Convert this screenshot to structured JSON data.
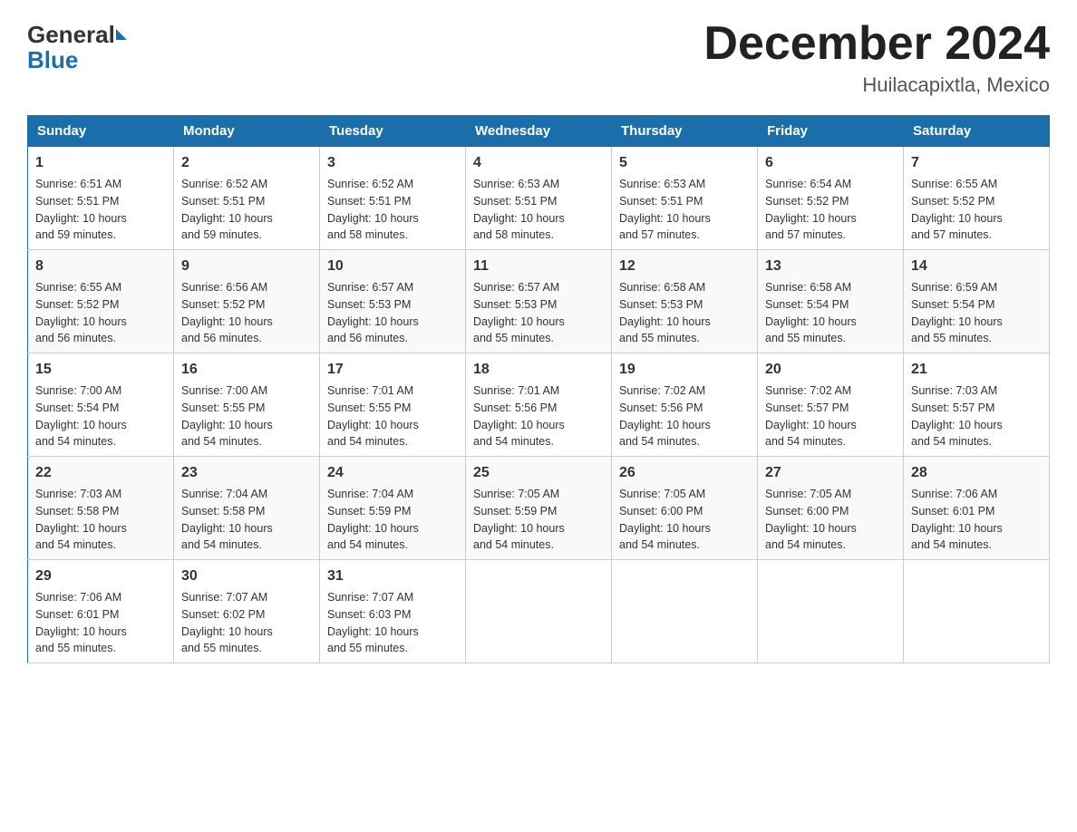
{
  "logo": {
    "general": "General",
    "blue": "Blue",
    "subtitle": "Blue"
  },
  "header": {
    "title": "December 2024",
    "location": "Huilacapixtla, Mexico"
  },
  "weekdays": [
    "Sunday",
    "Monday",
    "Tuesday",
    "Wednesday",
    "Thursday",
    "Friday",
    "Saturday"
  ],
  "weeks": [
    [
      {
        "day": "1",
        "sunrise": "Sunrise: 6:51 AM",
        "sunset": "Sunset: 5:51 PM",
        "daylight": "Daylight: 10 hours",
        "daylight2": "and 59 minutes."
      },
      {
        "day": "2",
        "sunrise": "Sunrise: 6:52 AM",
        "sunset": "Sunset: 5:51 PM",
        "daylight": "Daylight: 10 hours",
        "daylight2": "and 59 minutes."
      },
      {
        "day": "3",
        "sunrise": "Sunrise: 6:52 AM",
        "sunset": "Sunset: 5:51 PM",
        "daylight": "Daylight: 10 hours",
        "daylight2": "and 58 minutes."
      },
      {
        "day": "4",
        "sunrise": "Sunrise: 6:53 AM",
        "sunset": "Sunset: 5:51 PM",
        "daylight": "Daylight: 10 hours",
        "daylight2": "and 58 minutes."
      },
      {
        "day": "5",
        "sunrise": "Sunrise: 6:53 AM",
        "sunset": "Sunset: 5:51 PM",
        "daylight": "Daylight: 10 hours",
        "daylight2": "and 57 minutes."
      },
      {
        "day": "6",
        "sunrise": "Sunrise: 6:54 AM",
        "sunset": "Sunset: 5:52 PM",
        "daylight": "Daylight: 10 hours",
        "daylight2": "and 57 minutes."
      },
      {
        "day": "7",
        "sunrise": "Sunrise: 6:55 AM",
        "sunset": "Sunset: 5:52 PM",
        "daylight": "Daylight: 10 hours",
        "daylight2": "and 57 minutes."
      }
    ],
    [
      {
        "day": "8",
        "sunrise": "Sunrise: 6:55 AM",
        "sunset": "Sunset: 5:52 PM",
        "daylight": "Daylight: 10 hours",
        "daylight2": "and 56 minutes."
      },
      {
        "day": "9",
        "sunrise": "Sunrise: 6:56 AM",
        "sunset": "Sunset: 5:52 PM",
        "daylight": "Daylight: 10 hours",
        "daylight2": "and 56 minutes."
      },
      {
        "day": "10",
        "sunrise": "Sunrise: 6:57 AM",
        "sunset": "Sunset: 5:53 PM",
        "daylight": "Daylight: 10 hours",
        "daylight2": "and 56 minutes."
      },
      {
        "day": "11",
        "sunrise": "Sunrise: 6:57 AM",
        "sunset": "Sunset: 5:53 PM",
        "daylight": "Daylight: 10 hours",
        "daylight2": "and 55 minutes."
      },
      {
        "day": "12",
        "sunrise": "Sunrise: 6:58 AM",
        "sunset": "Sunset: 5:53 PM",
        "daylight": "Daylight: 10 hours",
        "daylight2": "and 55 minutes."
      },
      {
        "day": "13",
        "sunrise": "Sunrise: 6:58 AM",
        "sunset": "Sunset: 5:54 PM",
        "daylight": "Daylight: 10 hours",
        "daylight2": "and 55 minutes."
      },
      {
        "day": "14",
        "sunrise": "Sunrise: 6:59 AM",
        "sunset": "Sunset: 5:54 PM",
        "daylight": "Daylight: 10 hours",
        "daylight2": "and 55 minutes."
      }
    ],
    [
      {
        "day": "15",
        "sunrise": "Sunrise: 7:00 AM",
        "sunset": "Sunset: 5:54 PM",
        "daylight": "Daylight: 10 hours",
        "daylight2": "and 54 minutes."
      },
      {
        "day": "16",
        "sunrise": "Sunrise: 7:00 AM",
        "sunset": "Sunset: 5:55 PM",
        "daylight": "Daylight: 10 hours",
        "daylight2": "and 54 minutes."
      },
      {
        "day": "17",
        "sunrise": "Sunrise: 7:01 AM",
        "sunset": "Sunset: 5:55 PM",
        "daylight": "Daylight: 10 hours",
        "daylight2": "and 54 minutes."
      },
      {
        "day": "18",
        "sunrise": "Sunrise: 7:01 AM",
        "sunset": "Sunset: 5:56 PM",
        "daylight": "Daylight: 10 hours",
        "daylight2": "and 54 minutes."
      },
      {
        "day": "19",
        "sunrise": "Sunrise: 7:02 AM",
        "sunset": "Sunset: 5:56 PM",
        "daylight": "Daylight: 10 hours",
        "daylight2": "and 54 minutes."
      },
      {
        "day": "20",
        "sunrise": "Sunrise: 7:02 AM",
        "sunset": "Sunset: 5:57 PM",
        "daylight": "Daylight: 10 hours",
        "daylight2": "and 54 minutes."
      },
      {
        "day": "21",
        "sunrise": "Sunrise: 7:03 AM",
        "sunset": "Sunset: 5:57 PM",
        "daylight": "Daylight: 10 hours",
        "daylight2": "and 54 minutes."
      }
    ],
    [
      {
        "day": "22",
        "sunrise": "Sunrise: 7:03 AM",
        "sunset": "Sunset: 5:58 PM",
        "daylight": "Daylight: 10 hours",
        "daylight2": "and 54 minutes."
      },
      {
        "day": "23",
        "sunrise": "Sunrise: 7:04 AM",
        "sunset": "Sunset: 5:58 PM",
        "daylight": "Daylight: 10 hours",
        "daylight2": "and 54 minutes."
      },
      {
        "day": "24",
        "sunrise": "Sunrise: 7:04 AM",
        "sunset": "Sunset: 5:59 PM",
        "daylight": "Daylight: 10 hours",
        "daylight2": "and 54 minutes."
      },
      {
        "day": "25",
        "sunrise": "Sunrise: 7:05 AM",
        "sunset": "Sunset: 5:59 PM",
        "daylight": "Daylight: 10 hours",
        "daylight2": "and 54 minutes."
      },
      {
        "day": "26",
        "sunrise": "Sunrise: 7:05 AM",
        "sunset": "Sunset: 6:00 PM",
        "daylight": "Daylight: 10 hours",
        "daylight2": "and 54 minutes."
      },
      {
        "day": "27",
        "sunrise": "Sunrise: 7:05 AM",
        "sunset": "Sunset: 6:00 PM",
        "daylight": "Daylight: 10 hours",
        "daylight2": "and 54 minutes."
      },
      {
        "day": "28",
        "sunrise": "Sunrise: 7:06 AM",
        "sunset": "Sunset: 6:01 PM",
        "daylight": "Daylight: 10 hours",
        "daylight2": "and 54 minutes."
      }
    ],
    [
      {
        "day": "29",
        "sunrise": "Sunrise: 7:06 AM",
        "sunset": "Sunset: 6:01 PM",
        "daylight": "Daylight: 10 hours",
        "daylight2": "and 55 minutes."
      },
      {
        "day": "30",
        "sunrise": "Sunrise: 7:07 AM",
        "sunset": "Sunset: 6:02 PM",
        "daylight": "Daylight: 10 hours",
        "daylight2": "and 55 minutes."
      },
      {
        "day": "31",
        "sunrise": "Sunrise: 7:07 AM",
        "sunset": "Sunset: 6:03 PM",
        "daylight": "Daylight: 10 hours",
        "daylight2": "and 55 minutes."
      },
      null,
      null,
      null,
      null
    ]
  ]
}
